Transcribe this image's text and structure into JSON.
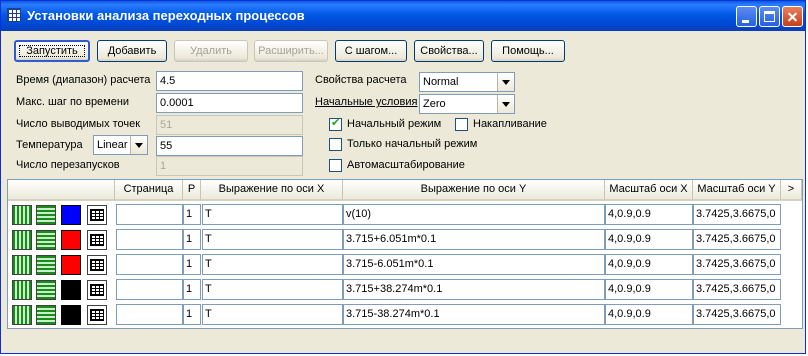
{
  "window": {
    "title": "Установки анализа переходных процессов"
  },
  "toolbar": {
    "run": "Запустить",
    "add": "Добавить",
    "delete": "Удалить",
    "expand": "Расширить...",
    "stepping": "С шагом...",
    "properties": "Свойства...",
    "help": "Помощь..."
  },
  "params": {
    "time_range_label": "Время (диапазон) расчета",
    "time_range_value": "4.5",
    "max_step_label": "Макс. шаг по времени",
    "max_step_value": "0.0001",
    "points_label": "Число выводимых точек",
    "points_value": "51",
    "temp_label": "Температура",
    "temp_mode": "Linear",
    "temp_value": "55",
    "restarts_label": "Число перезапусков",
    "restarts_value": "1"
  },
  "calc": {
    "props_label": "Свойства расчета",
    "props_value": "Normal",
    "init_label": "Начальные условия",
    "init_value": "Zero",
    "initial_mode_label": "Начальный режим",
    "initial_mode_checked": true,
    "accumulate_label": "Накапливание",
    "accumulate_checked": false,
    "only_initial_label": "Только начальный режим",
    "only_initial_checked": false,
    "autoscale_label": "Автомасштабирование",
    "autoscale_checked": false
  },
  "table": {
    "headers": {
      "page": "Страница",
      "p": "P",
      "x_expr": "Выражение по оси X",
      "y_expr": "Выражение по оси Y",
      "x_scale": "Масштаб оси X",
      "y_scale": "Масштаб оси Y",
      "more": ">"
    },
    "rows": [
      {
        "color": "#0000ff",
        "page": "",
        "p": "1",
        "x": "T",
        "y": "v(10)",
        "xs": "4,0.9,0.9",
        "ys": "3.7425,3.6675,0"
      },
      {
        "color": "#ff0000",
        "page": "",
        "p": "1",
        "x": "T",
        "y": "3.715+6.051m*0.1",
        "xs": "4,0.9,0.9",
        "ys": "3.7425,3.6675,0"
      },
      {
        "color": "#ff0000",
        "page": "",
        "p": "1",
        "x": "T",
        "y": "3.715-6.051m*0.1",
        "xs": "4,0.9,0.9",
        "ys": "3.7425,3.6675,0"
      },
      {
        "color": "#000000",
        "page": "",
        "p": "1",
        "x": "T",
        "y": "3.715+38.274m*0.1",
        "xs": "4,0.9,0.9",
        "ys": "3.7425,3.6675,0"
      },
      {
        "color": "#000000",
        "page": "",
        "p": "1",
        "x": "T",
        "y": "3.715-38.274m*0.1",
        "xs": "4,0.9,0.9",
        "ys": "3.7425,3.6675,0"
      }
    ]
  },
  "icons": [
    "app-icon",
    "minimize-icon",
    "maximize-icon",
    "close-icon",
    "vertical-grid-icon",
    "horizontal-grid-icon",
    "color-swatch-icon",
    "table-icon",
    "checkmark-icon",
    "dropdown-arrow-icon"
  ]
}
